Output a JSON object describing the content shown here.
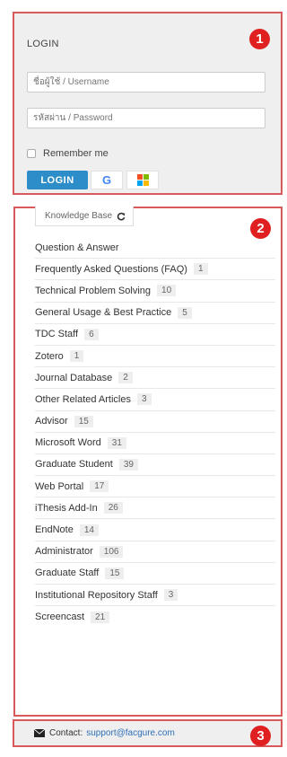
{
  "login": {
    "title": "LOGIN",
    "username_placeholder": "ชื่อผู้ใช้ / Username",
    "password_placeholder": "รหัสผ่าน / Password",
    "remember_label": "Remember me",
    "login_button": "LOGIN",
    "google_icon": "G"
  },
  "badges": {
    "one": "1",
    "two": "2",
    "three": "3"
  },
  "knowledge_base": {
    "tab_label": "Knowledge Base",
    "items": [
      {
        "label": "Question & Answer",
        "count": ""
      },
      {
        "label": "Frequently Asked Questions (FAQ)",
        "count": "1"
      },
      {
        "label": "Technical Problem Solving",
        "count": "10"
      },
      {
        "label": "General Usage & Best Practice",
        "count": "5"
      },
      {
        "label": "TDC Staff",
        "count": "6"
      },
      {
        "label": "Zotero",
        "count": "1"
      },
      {
        "label": "Journal Database",
        "count": "2"
      },
      {
        "label": "Other Related Articles",
        "count": "3"
      },
      {
        "label": "Advisor",
        "count": "15"
      },
      {
        "label": "Microsoft Word",
        "count": "31"
      },
      {
        "label": "Graduate Student",
        "count": "39"
      },
      {
        "label": "Web Portal",
        "count": "17"
      },
      {
        "label": "iThesis Add-In",
        "count": "26"
      },
      {
        "label": "EndNote",
        "count": "14"
      },
      {
        "label": "Administrator",
        "count": "106"
      },
      {
        "label": "Graduate Staff",
        "count": "15"
      },
      {
        "label": "Institutional Repository Staff",
        "count": "3"
      },
      {
        "label": "Screencast",
        "count": "21"
      }
    ]
  },
  "contact": {
    "label": "Contact:",
    "email": "support@facgure.com"
  }
}
